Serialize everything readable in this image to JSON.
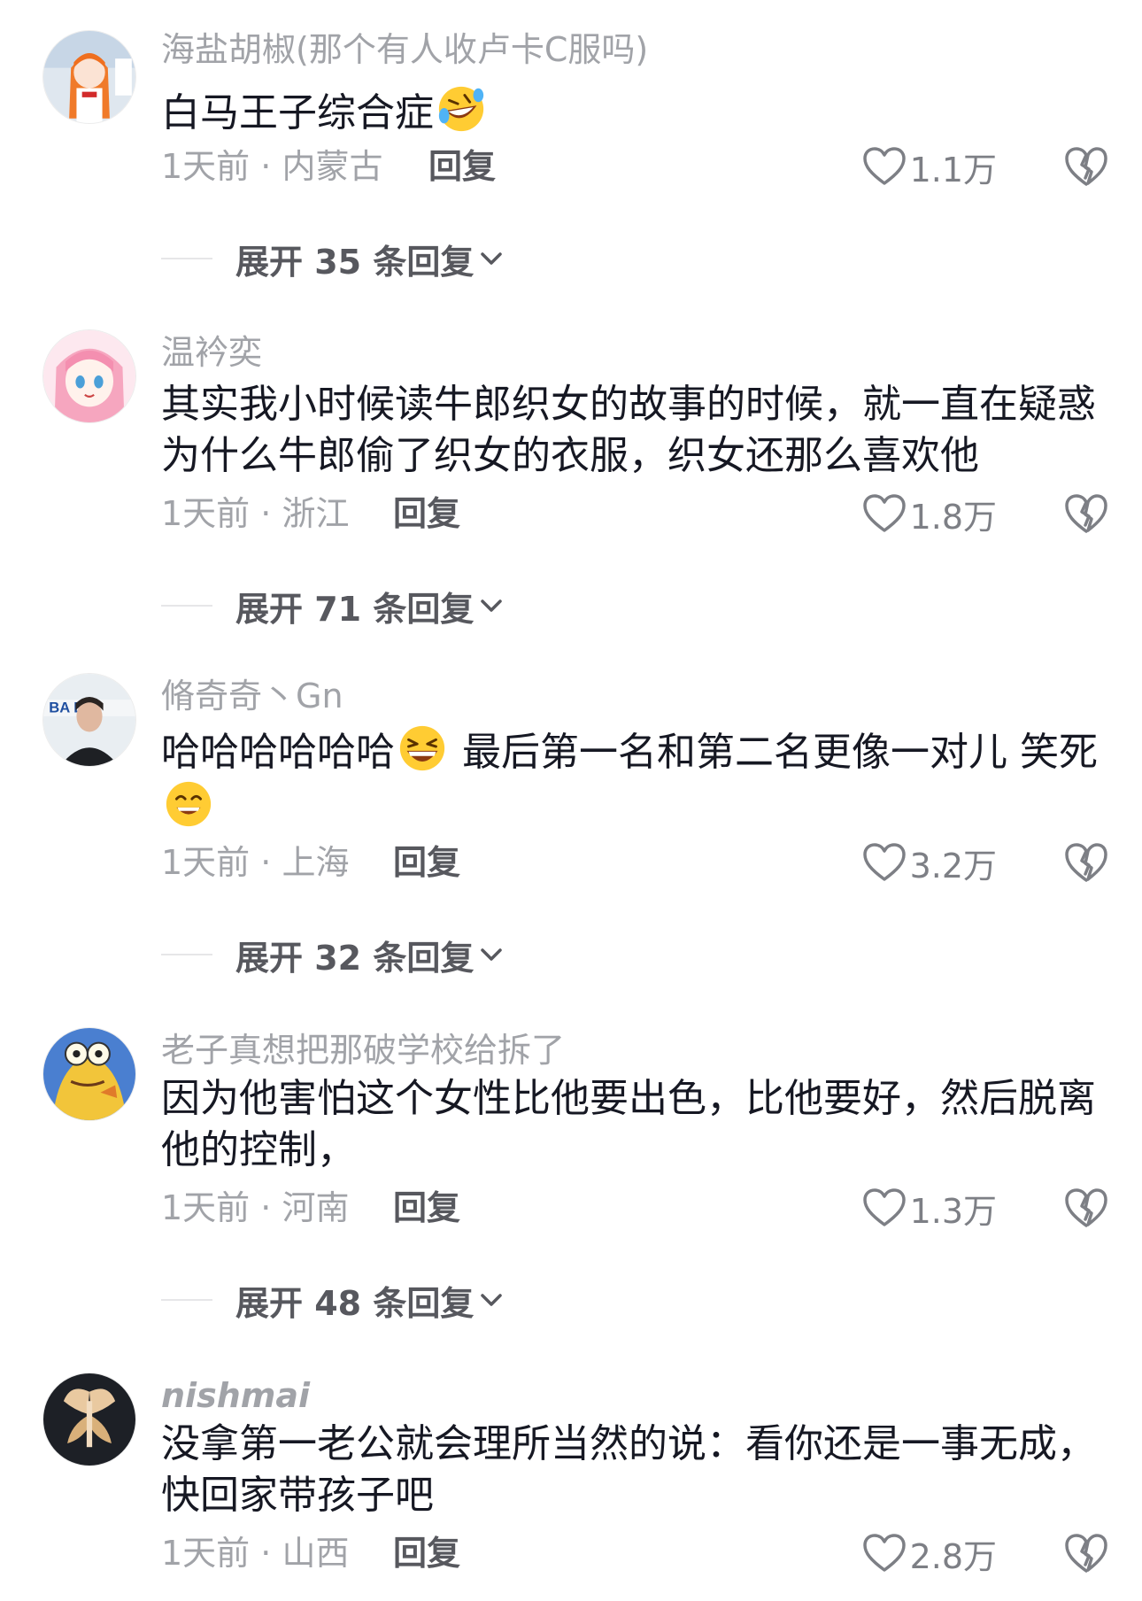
{
  "comments": [
    {
      "username": "海盐胡椒(那个有人收卢卡C服吗)",
      "text_parts": [
        "白马王子综合症"
      ],
      "emoji": "rolling-laughing-emoji",
      "time": "1天前",
      "location": "内蒙古",
      "reply_label": "回复",
      "likes": "1.1万",
      "expand_label": "展开 35 条回复"
    },
    {
      "username": "温衿奕",
      "text_parts": [
        "其实我小时候读牛郎织女的故事的时候，就一直在疑惑为什么牛郎偷了织女的衣服，织女还那么喜欢他"
      ],
      "time": "1天前",
      "location": "浙江",
      "reply_label": "回复",
      "likes": "1.8万",
      "expand_label": "展开 71 条回复"
    },
    {
      "username": "脩奇奇丶Gn",
      "text_parts": [
        "哈哈哈哈哈哈",
        " 最后第一名和第二名更像一对儿 笑死"
      ],
      "time": "1天前",
      "location": "上海",
      "reply_label": "回复",
      "likes": "3.2万",
      "expand_label": "展开 32 条回复"
    },
    {
      "username": "老子真想把那破学校给拆了",
      "text_parts": [
        "因为他害怕这个女性比他要出色，比他要好，然后脱离他的控制，"
      ],
      "time": "1天前",
      "location": "河南",
      "reply_label": "回复",
      "likes": "1.3万",
      "expand_label": "展开 48 条回复"
    },
    {
      "username": "nishmai",
      "text_parts": [
        "没拿第一老公就会理所当然的说：看你还是一事无成，快回家带孩子吧"
      ],
      "time": "1天前",
      "location": "山西",
      "reply_label": "回复",
      "likes": "2.8万"
    }
  ],
  "colors": {
    "username": "#a1a3a8",
    "body_text": "#161823",
    "meta": "#a1a3a8",
    "reply": "#57585e",
    "icon": "#7d7f85"
  },
  "icons": [
    "heart-icon",
    "broken-heart-icon",
    "chevron-down-icon"
  ]
}
